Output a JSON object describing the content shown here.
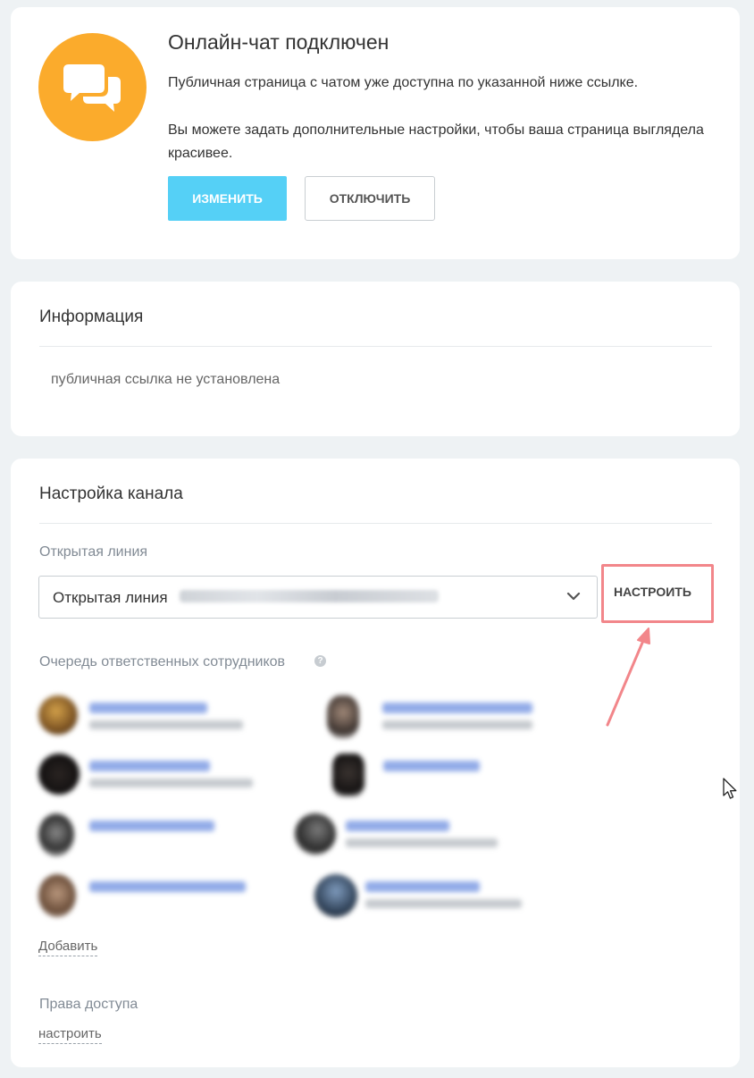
{
  "header_card": {
    "title": "Онлайн-чат подключен",
    "description_1": "Публичная страница с чатом уже доступна по указанной ниже ссылке.",
    "description_2": "Вы можете задать дополнительные настройки, чтобы ваша страница выглядела красивее.",
    "edit_button": "ИЗМЕНИТЬ",
    "disable_button": "ОТКЛЮЧИТЬ",
    "icon": "chat-bubbles-icon",
    "icon_color": "#fbab2c"
  },
  "info_card": {
    "title": "Информация",
    "public_link_text": "публичная ссылка не установлена"
  },
  "channel_card": {
    "title": "Настройка канала",
    "open_line_label": "Открытая линия",
    "open_line_selected": "Открытая линия",
    "configure_button": "НАСТРОИТЬ",
    "queue_label": "Очередь ответственных сотрудников",
    "help_icon": "?",
    "add_link": "Добавить",
    "access_rights_label": "Права доступа",
    "access_rights_link": "настроить"
  },
  "colors": {
    "primary_button": "#55d0f6",
    "highlight": "#f2868a",
    "background": "#eef2f4"
  }
}
